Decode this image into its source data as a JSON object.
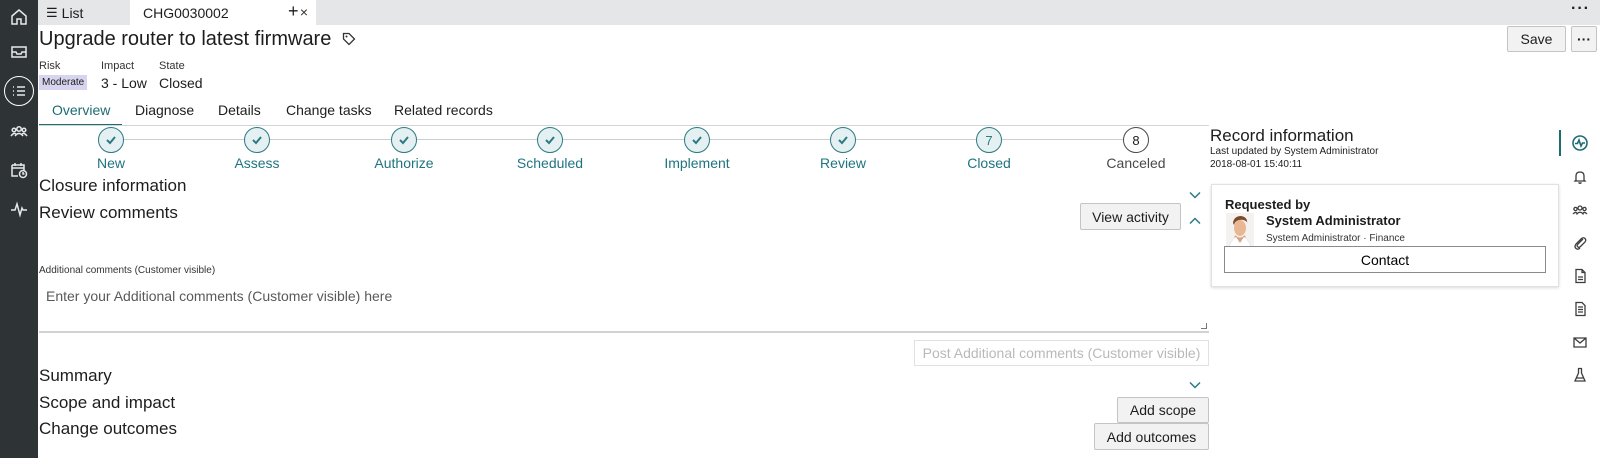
{
  "rail": {
    "icons": [
      "home-icon",
      "inbox-icon",
      "list-icon",
      "groups-icon",
      "calendar-clock-icon",
      "activity-icon"
    ],
    "active": "list-icon"
  },
  "tabs": {
    "list_label": "List",
    "active_label": "CHG0030002",
    "close_glyph": "×",
    "add_glyph": "+",
    "more_glyph": "···"
  },
  "header": {
    "title": "Upgrade router to latest firmware",
    "save_label": "Save",
    "more_glyph": "···"
  },
  "meta": {
    "risk_label": "Risk",
    "risk_value": "Moderate",
    "impact_label": "Impact",
    "impact_value": "3 - Low",
    "state_label": "State",
    "state_value": "Closed"
  },
  "subtabs": [
    "Overview",
    "Diagnose",
    "Details",
    "Change tasks",
    "Related records"
  ],
  "stepper": [
    {
      "label": "New",
      "status": "done"
    },
    {
      "label": "Assess",
      "status": "done"
    },
    {
      "label": "Authorize",
      "status": "done"
    },
    {
      "label": "Scheduled",
      "status": "done"
    },
    {
      "label": "Implement",
      "status": "done"
    },
    {
      "label": "Review",
      "status": "done"
    },
    {
      "label": "Closed",
      "status": "current",
      "number": "7"
    },
    {
      "label": "Canceled",
      "status": "pending",
      "number": "8"
    }
  ],
  "sections": {
    "closure_title": "Closure information",
    "review_title": "Review comments",
    "view_activity_label": "View activity",
    "comments_label": "Additional comments (Customer visible)",
    "comments_placeholder": "Enter your Additional comments (Customer visible) here",
    "post_label": "Post Additional comments (Customer visible)",
    "summary_title": "Summary",
    "scope_title": "Scope and impact",
    "add_scope_label": "Add scope",
    "outcomes_title": "Change outcomes",
    "add_outcomes_label": "Add outcomes"
  },
  "record": {
    "title": "Record information",
    "updated_by": "Last updated by System Administrator",
    "updated_at": "2018-08-01 15:40:11",
    "requested_by_label": "Requested by",
    "requester_name": "System Administrator",
    "requester_sub": "System Administrator · Finance",
    "contact_label": "Contact"
  },
  "right_rail": {
    "icons": [
      "activity-icon",
      "bell-icon",
      "groups-icon",
      "paperclip-icon",
      "document-icon",
      "document-lines-icon",
      "mail-icon",
      "flask-icon"
    ],
    "active": "activity-icon"
  },
  "colors": {
    "accent": "#1e6c73",
    "rail_bg": "#2e3436",
    "risk_badge": "#d6d4ee"
  }
}
